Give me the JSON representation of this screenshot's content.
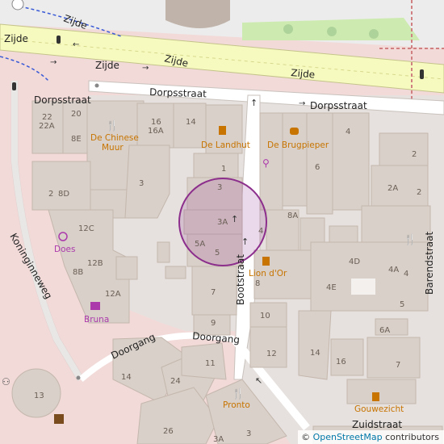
{
  "map": {
    "streets": {
      "zijde": "Zijde",
      "dorpsstraat": "Dorpsstraat",
      "bootstraat": "Bootstraat",
      "barendstraat": "Barendstraat",
      "koninginneweg": "Koninginneweg",
      "doorgang": "Doorgang",
      "zuidstraat": "Zuidstraat"
    },
    "pois": {
      "chinese_muur": "De Chinese Muur",
      "landhut": "De Landhut",
      "brugpieper": "De Brugpieper",
      "does": "Does",
      "bruna": "Bruna",
      "lion_dor": "Lion d'Or",
      "pronto": "Pronto",
      "gouwezicht": "Gouwezicht"
    },
    "house_numbers": [
      "22",
      "22A",
      "20",
      "8E",
      "16",
      "16A",
      "14",
      "1",
      "3",
      "3A",
      "5A",
      "5",
      "2",
      "8D",
      "3",
      "6",
      "4",
      "2",
      "2A",
      "2",
      "12C",
      "12B",
      "8B",
      "12A",
      "8A",
      "4",
      "8",
      "4D",
      "4A",
      "4",
      "4E",
      "5",
      "7",
      "9",
      "10",
      "12",
      "14",
      "16",
      "6A",
      "7",
      "11",
      "14",
      "24",
      "13",
      "26",
      "3A",
      "3"
    ]
  },
  "colors": {
    "background": "#f2dad9",
    "building": "#d9d0c9",
    "road_primary": "#f7fabf",
    "road": "#ffffff",
    "grass": "#cdebb0",
    "highlight_circle": "#8c2e8c",
    "poi_orange": "#c77400",
    "poi_purple": "#ac39ac"
  },
  "attribution": {
    "copyright": "©",
    "link_text": "OpenStreetMap",
    "suffix": "contributors"
  }
}
